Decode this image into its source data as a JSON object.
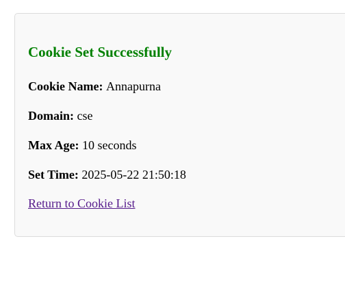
{
  "card": {
    "title": "Cookie Set Successfully",
    "fields": [
      {
        "label": "Cookie Name:",
        "value": "Annapurna"
      },
      {
        "label": "Domain:",
        "value": "cse"
      },
      {
        "label": "Max Age:",
        "value": "10 seconds"
      },
      {
        "label": "Set Time:",
        "value": "2025-05-22 21:50:18"
      }
    ],
    "return_link": "Return to Cookie List"
  },
  "colors": {
    "title": "#008000",
    "link_visited": "#551a8b",
    "card_background": "#f9f9f9",
    "card_border": "#dcdcdc"
  }
}
